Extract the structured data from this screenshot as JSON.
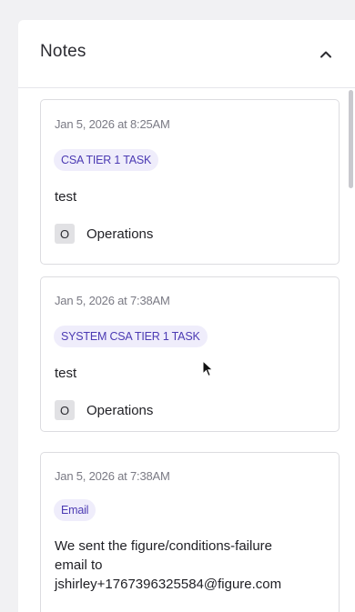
{
  "panel": {
    "title": "Notes",
    "collapse_icon": "chevron-up-icon"
  },
  "notes": [
    {
      "date": "Jan 5, 2026 at 8:25AM",
      "tag": "CSA TIER 1 TASK",
      "body": "test",
      "team_initial": "O",
      "team": "Operations"
    },
    {
      "date": "Jan 5, 2026 at 7:38AM",
      "tag": "SYSTEM CSA TIER 1 TASK",
      "body": "test",
      "team_initial": "O",
      "team": "Operations"
    },
    {
      "date": "Jan 5, 2026 at 7:38AM",
      "tag": "Email",
      "body_lines": [
        "We sent the figure/conditions-failure",
        "email to",
        "jshirley+1767396325584@figure.com"
      ]
    }
  ],
  "colors": {
    "tag_text": "#4b3ab3",
    "tag_background": "#efedfb"
  }
}
